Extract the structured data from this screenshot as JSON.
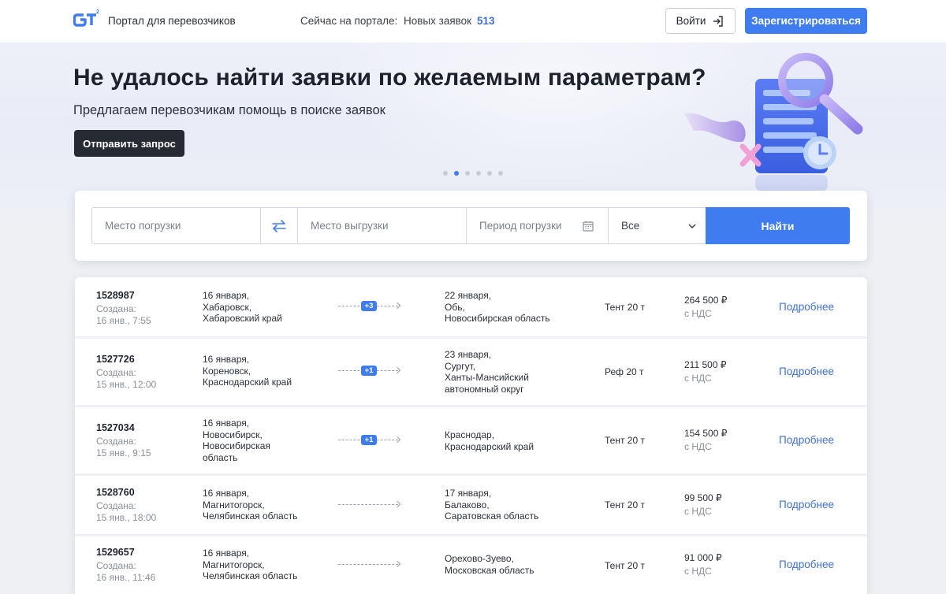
{
  "header": {
    "portal_name": "Портал для перевозчиков",
    "now_on_portal": "Сейчас на портале:",
    "new_orders_label": "Новых заявок",
    "new_orders_count": "513",
    "login_label": "Войти",
    "register_label": "Зарегистрироваться"
  },
  "hero": {
    "title": "Не удалось найти заявки по желаемым параметрам?",
    "subtitle": "Предлагаем перевозчикам помощь в поиске заявок",
    "cta_label": "Отправить запрос",
    "slides_count": 6,
    "active_slide": 2
  },
  "search": {
    "loading_placeholder": "Место погрузки",
    "unloading_placeholder": "Место выгрузки",
    "period_placeholder": "Период погрузки",
    "type_value": "Все",
    "find_label": "Найти"
  },
  "orders": [
    {
      "id": "1528987",
      "created_label": "Создана:",
      "created": "16 янв., 7:55",
      "from_date": "16 января,",
      "from_lines": [
        "Хабаровск,",
        "Хабаровский край"
      ],
      "extra_points": "+3",
      "to_date": "22 января,",
      "to_lines": [
        "Обь,",
        "Новосибирская область"
      ],
      "truck": "Тент 20 т",
      "price": "264 500 ₽",
      "vat": "с НДС",
      "more": "Подробнее"
    },
    {
      "id": "1527726",
      "created_label": "Создана:",
      "created": "15 янв., 12:00",
      "from_date": "16 января,",
      "from_lines": [
        "Кореновск,",
        "Краснодарский край"
      ],
      "extra_points": "+1",
      "to_date": "23 января,",
      "to_lines": [
        "Сургут,",
        "Ханты-Мансийский",
        "автономный округ"
      ],
      "truck": "Реф 20 т",
      "price": "211 500 ₽",
      "vat": "с НДС",
      "more": "Подробнее"
    },
    {
      "id": "1527034",
      "created_label": "Создана:",
      "created": "15 янв., 9:15",
      "from_date": "16 января,",
      "from_lines": [
        "Новосибирск,",
        "Новосибирская",
        "область"
      ],
      "extra_points": "+1",
      "to_date": "",
      "to_lines": [
        "Краснодар,",
        "Краснодарский край"
      ],
      "truck": "Тент 20 т",
      "price": "154 500 ₽",
      "vat": "с НДС",
      "more": "Подробнее"
    },
    {
      "id": "1528760",
      "created_label": "Создана:",
      "created": "15 янв., 18:00",
      "from_date": "16 января,",
      "from_lines": [
        "Магнитогорск,",
        "Челябинская область"
      ],
      "extra_points": "",
      "to_date": "17 января,",
      "to_lines": [
        "Балаково,",
        "Саратовская область"
      ],
      "truck": "Тент 20 т",
      "price": "99 500 ₽",
      "vat": "с НДС",
      "more": "Подробнее"
    },
    {
      "id": "1529657",
      "created_label": "Создана:",
      "created": "16 янв., 11:46",
      "from_date": "16 января,",
      "from_lines": [
        "Магнитогорск,",
        "Челябинская область"
      ],
      "extra_points": "",
      "to_date": "",
      "to_lines": [
        "Орехово-Зуево,",
        "Московская область"
      ],
      "truck": "Тент 20 т",
      "price": "91 000 ₽",
      "vat": "с НДС",
      "more": "Подробнее"
    }
  ],
  "colors": {
    "accent": "#3f7cf0",
    "dark_button": "#262a33",
    "link": "#3e6fd8"
  }
}
